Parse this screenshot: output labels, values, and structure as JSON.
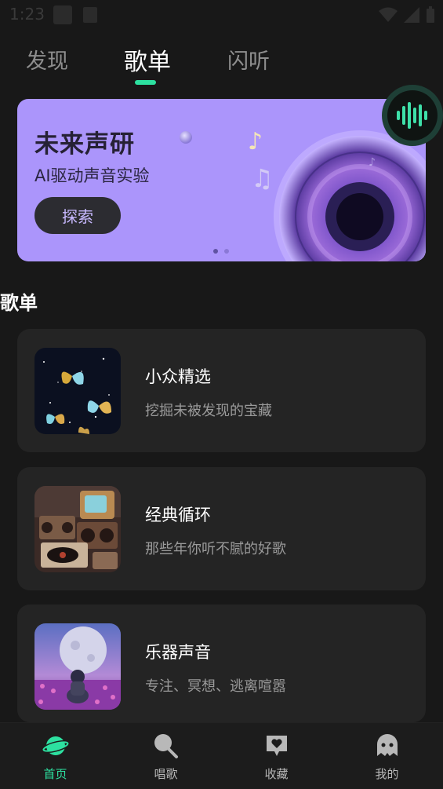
{
  "status_bar": {
    "time": "1:23"
  },
  "tabs": [
    {
      "label": "发现",
      "active": false
    },
    {
      "label": "歌单",
      "active": true
    },
    {
      "label": "闪听",
      "active": false
    }
  ],
  "banner": {
    "title": "未来声研",
    "subtitle": "AI驱动声音实验",
    "button_label": "探索",
    "page_count": 2,
    "active_page": 1
  },
  "section": {
    "title": "歌单"
  },
  "playlists": [
    {
      "title": "小众精选",
      "description": "挖掘未被发现的宝藏"
    },
    {
      "title": "经典循环",
      "description": "那些年你听不腻的好歌"
    },
    {
      "title": "乐器声音",
      "description": "专注、冥想、逃离喧嚣"
    }
  ],
  "bottom_nav": [
    {
      "label": "首页",
      "icon": "planet-icon",
      "active": true
    },
    {
      "label": "唱歌",
      "icon": "microphone-icon",
      "active": false
    },
    {
      "label": "收藏",
      "icon": "heart-message-icon",
      "active": false
    },
    {
      "label": "我的",
      "icon": "ghost-icon",
      "active": false
    }
  ],
  "colors": {
    "accent": "#2de0a0",
    "banner": "#ab95fb",
    "background": "#181818",
    "card": "#242424"
  }
}
